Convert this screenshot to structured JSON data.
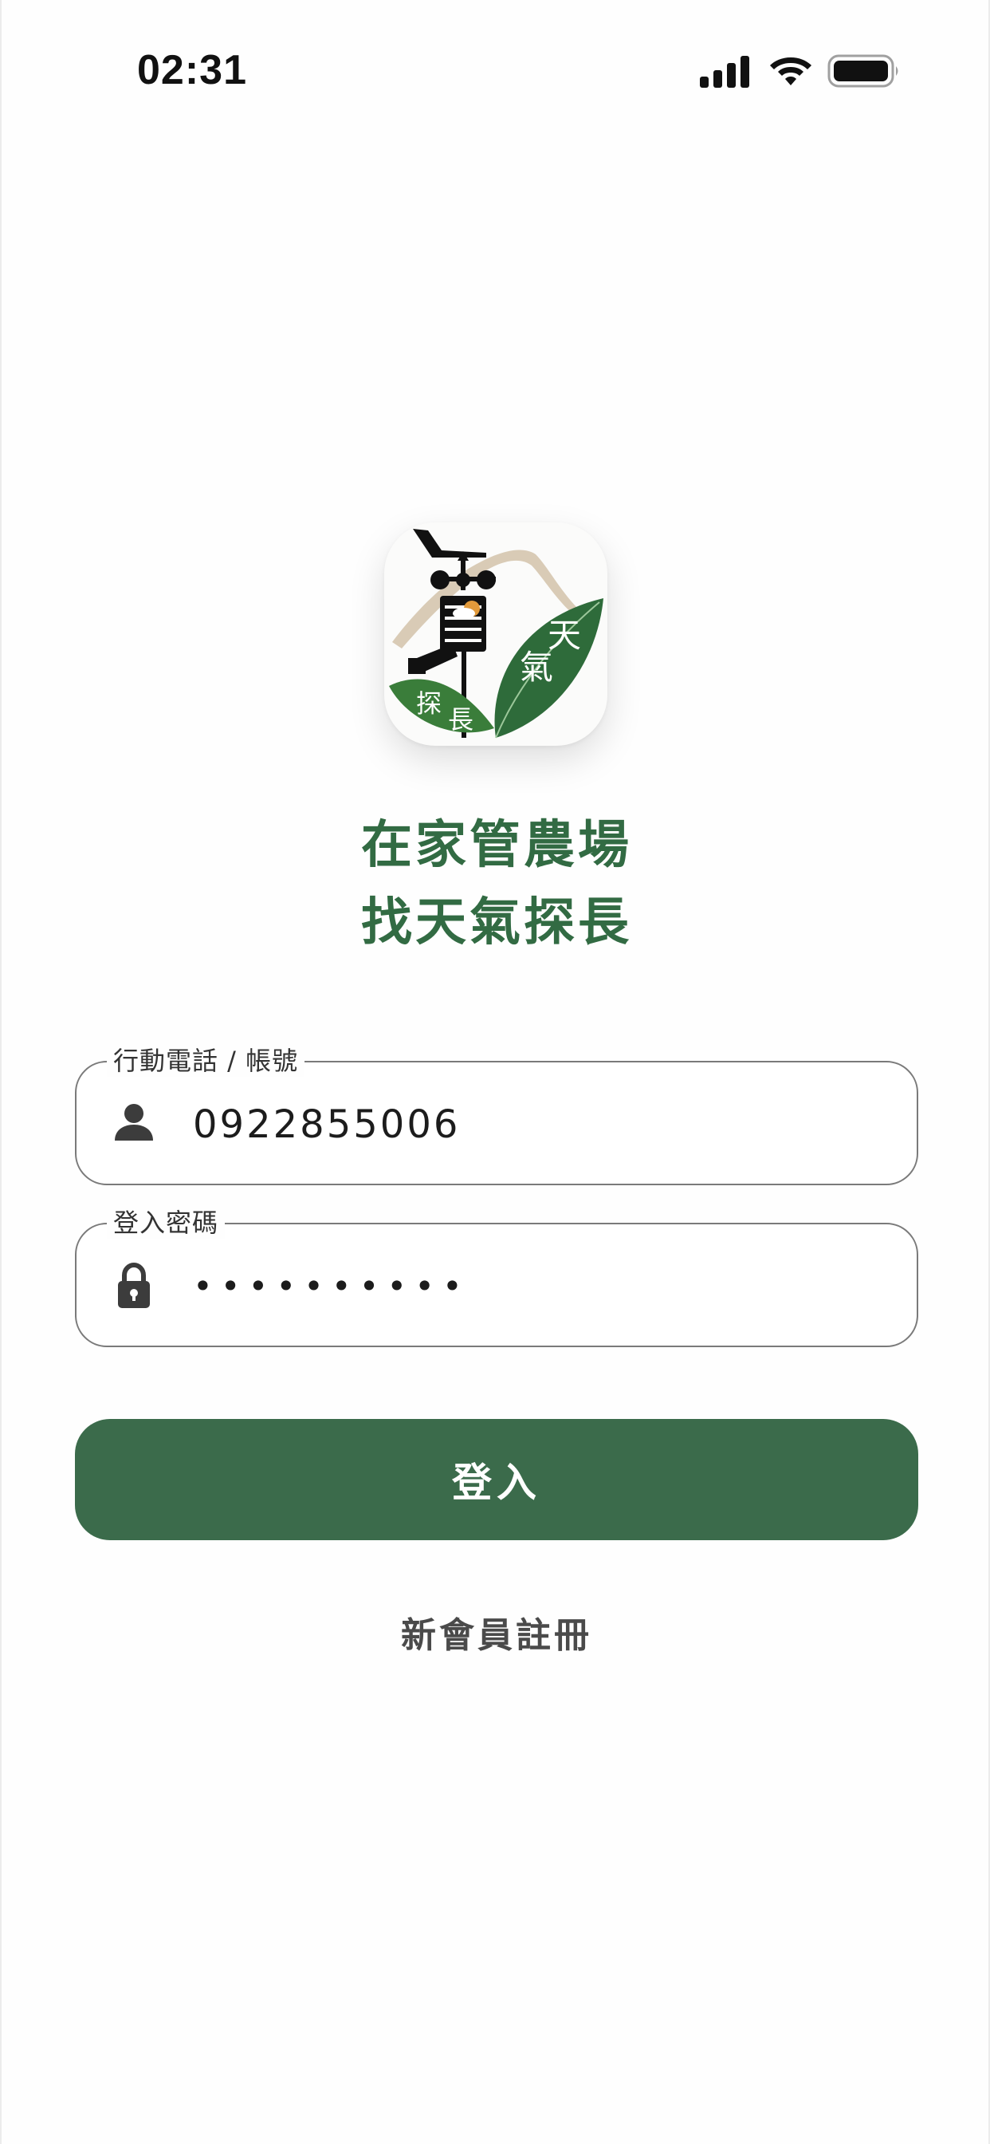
{
  "status_bar": {
    "time": "02:31",
    "icons": [
      "cellular-signal-icon",
      "wifi-icon",
      "battery-icon"
    ]
  },
  "logo": {
    "text_top": "天",
    "text_mid": "氣",
    "text_left1": "探",
    "text_left2": "長"
  },
  "slogan": {
    "line1": "在家管農場",
    "line2": "找天氣探長"
  },
  "account_field": {
    "label": "行動電話 / 帳號",
    "value": "0922855006",
    "icon": "person-icon"
  },
  "password_field": {
    "label": "登入密碼",
    "value": "••••••••••",
    "icon": "lock-icon"
  },
  "login_button": {
    "label": "登入"
  },
  "register_link": {
    "label": "新會員註冊"
  },
  "colors": {
    "brand_green": "#3b6b4b",
    "slogan_green": "#326b43",
    "leaf_green": "#2e6b3a",
    "border_gray": "#7a7a7a"
  }
}
